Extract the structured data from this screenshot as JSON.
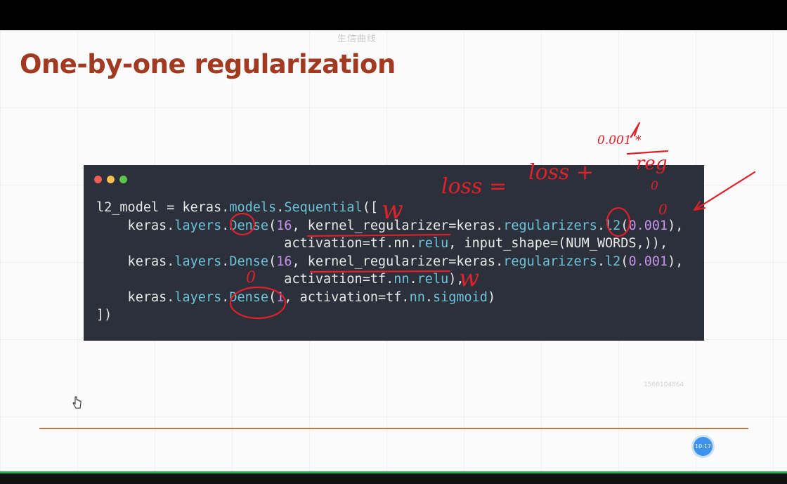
{
  "watermark_top": "生信曲线",
  "slide": {
    "title": "One-by-one regularization",
    "watermark_id": "1566104864",
    "clock": "10:17"
  },
  "code_window": {
    "dot_colors": [
      "#ed5e57",
      "#f5bf4f",
      "#5dc445"
    ],
    "lines": [
      [
        {
          "t": "l2_model = keras."
        },
        {
          "t": "models",
          "k": "mod"
        },
        {
          "t": "."
        },
        {
          "t": "Sequential",
          "k": "mod"
        },
        {
          "t": "(["
        }
      ],
      [
        {
          "t": "    keras."
        },
        {
          "t": "layers",
          "k": "mod"
        },
        {
          "t": "."
        },
        {
          "t": "Dense",
          "k": "mod"
        },
        {
          "t": "("
        },
        {
          "t": "16",
          "k": "num"
        },
        {
          "t": ", kernel_regularizer=keras."
        },
        {
          "t": "regularizers",
          "k": "mod"
        },
        {
          "t": "."
        },
        {
          "t": "l2",
          "k": "mod"
        },
        {
          "t": "("
        },
        {
          "t": "0.001",
          "k": "num"
        },
        {
          "t": "),"
        }
      ],
      [
        {
          "t": "                        activation=tf.nn."
        },
        {
          "t": "relu",
          "k": "mod"
        },
        {
          "t": ", input_shape=(NUM_WORDS,)),"
        }
      ],
      [
        {
          "t": "    keras."
        },
        {
          "t": "layers",
          "k": "mod"
        },
        {
          "t": "."
        },
        {
          "t": "Dense",
          "k": "mod"
        },
        {
          "t": "("
        },
        {
          "t": "16",
          "k": "num"
        },
        {
          "t": ", kernel_regularizer=keras."
        },
        {
          "t": "regularizers",
          "k": "mod"
        },
        {
          "t": "."
        },
        {
          "t": "l2",
          "k": "mod"
        },
        {
          "t": "("
        },
        {
          "t": "0.001",
          "k": "num"
        },
        {
          "t": "),"
        }
      ],
      [
        {
          "t": "                        activation=tf."
        },
        {
          "t": "nn",
          "k": "mod"
        },
        {
          "t": "."
        },
        {
          "t": "relu",
          "k": "mod"
        },
        {
          "t": "),"
        }
      ],
      [
        {
          "t": "    keras."
        },
        {
          "t": "layers",
          "k": "mod"
        },
        {
          "t": "."
        },
        {
          "t": "Dense",
          "k": "mod"
        },
        {
          "t": "("
        },
        {
          "t": "1",
          "k": "num"
        },
        {
          "t": ", activation=tf."
        },
        {
          "t": "nn",
          "k": "mod"
        },
        {
          "t": "."
        },
        {
          "t": "sigmoid",
          "k": "mod"
        },
        {
          "t": ")"
        }
      ],
      [
        {
          "t": "])"
        }
      ]
    ]
  },
  "annotations": {
    "ink_color": "#e0202a",
    "arrow_color": "#e0202a",
    "formula_lhs": "loss =",
    "formula_rhs": "loss +",
    "fraction_num": "0.001 *",
    "fraction_den": "reg",
    "zero_a": "0",
    "zero_b": "0",
    "zero_c": "0",
    "w_a": "w",
    "w_b": "w"
  },
  "colors": {
    "title": "#a23a22",
    "code_bg": "#2c303b",
    "code_module": "#6cc3d9",
    "code_number": "#c792ea",
    "divider": "#c7753f",
    "green_line": "#1fb34a"
  }
}
